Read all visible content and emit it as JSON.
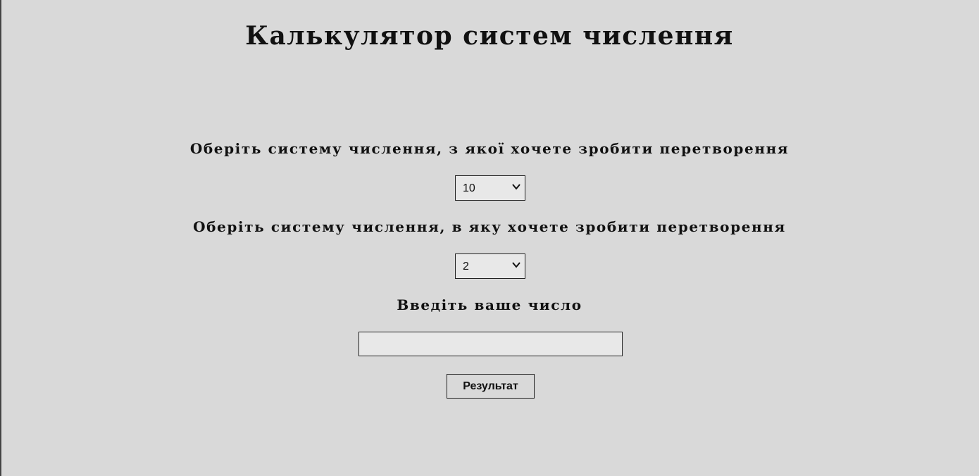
{
  "page": {
    "title": "Калькулятор систем числення"
  },
  "form": {
    "from_label": "Оберіть систему числення, з якої хочете зробити перетворення",
    "from_value": "10",
    "to_label": "Оберіть систему числення, в яку хочете зробити перетворення",
    "to_value": "2",
    "number_label": "Введіть ваше число",
    "number_value": "",
    "submit_label": "Результат"
  },
  "icons": {
    "select_arrow": "chevron-down-icon"
  },
  "colors": {
    "background": "#d9d9d9",
    "field_background": "#e8e8e8",
    "border": "#222222",
    "text": "#111111"
  }
}
